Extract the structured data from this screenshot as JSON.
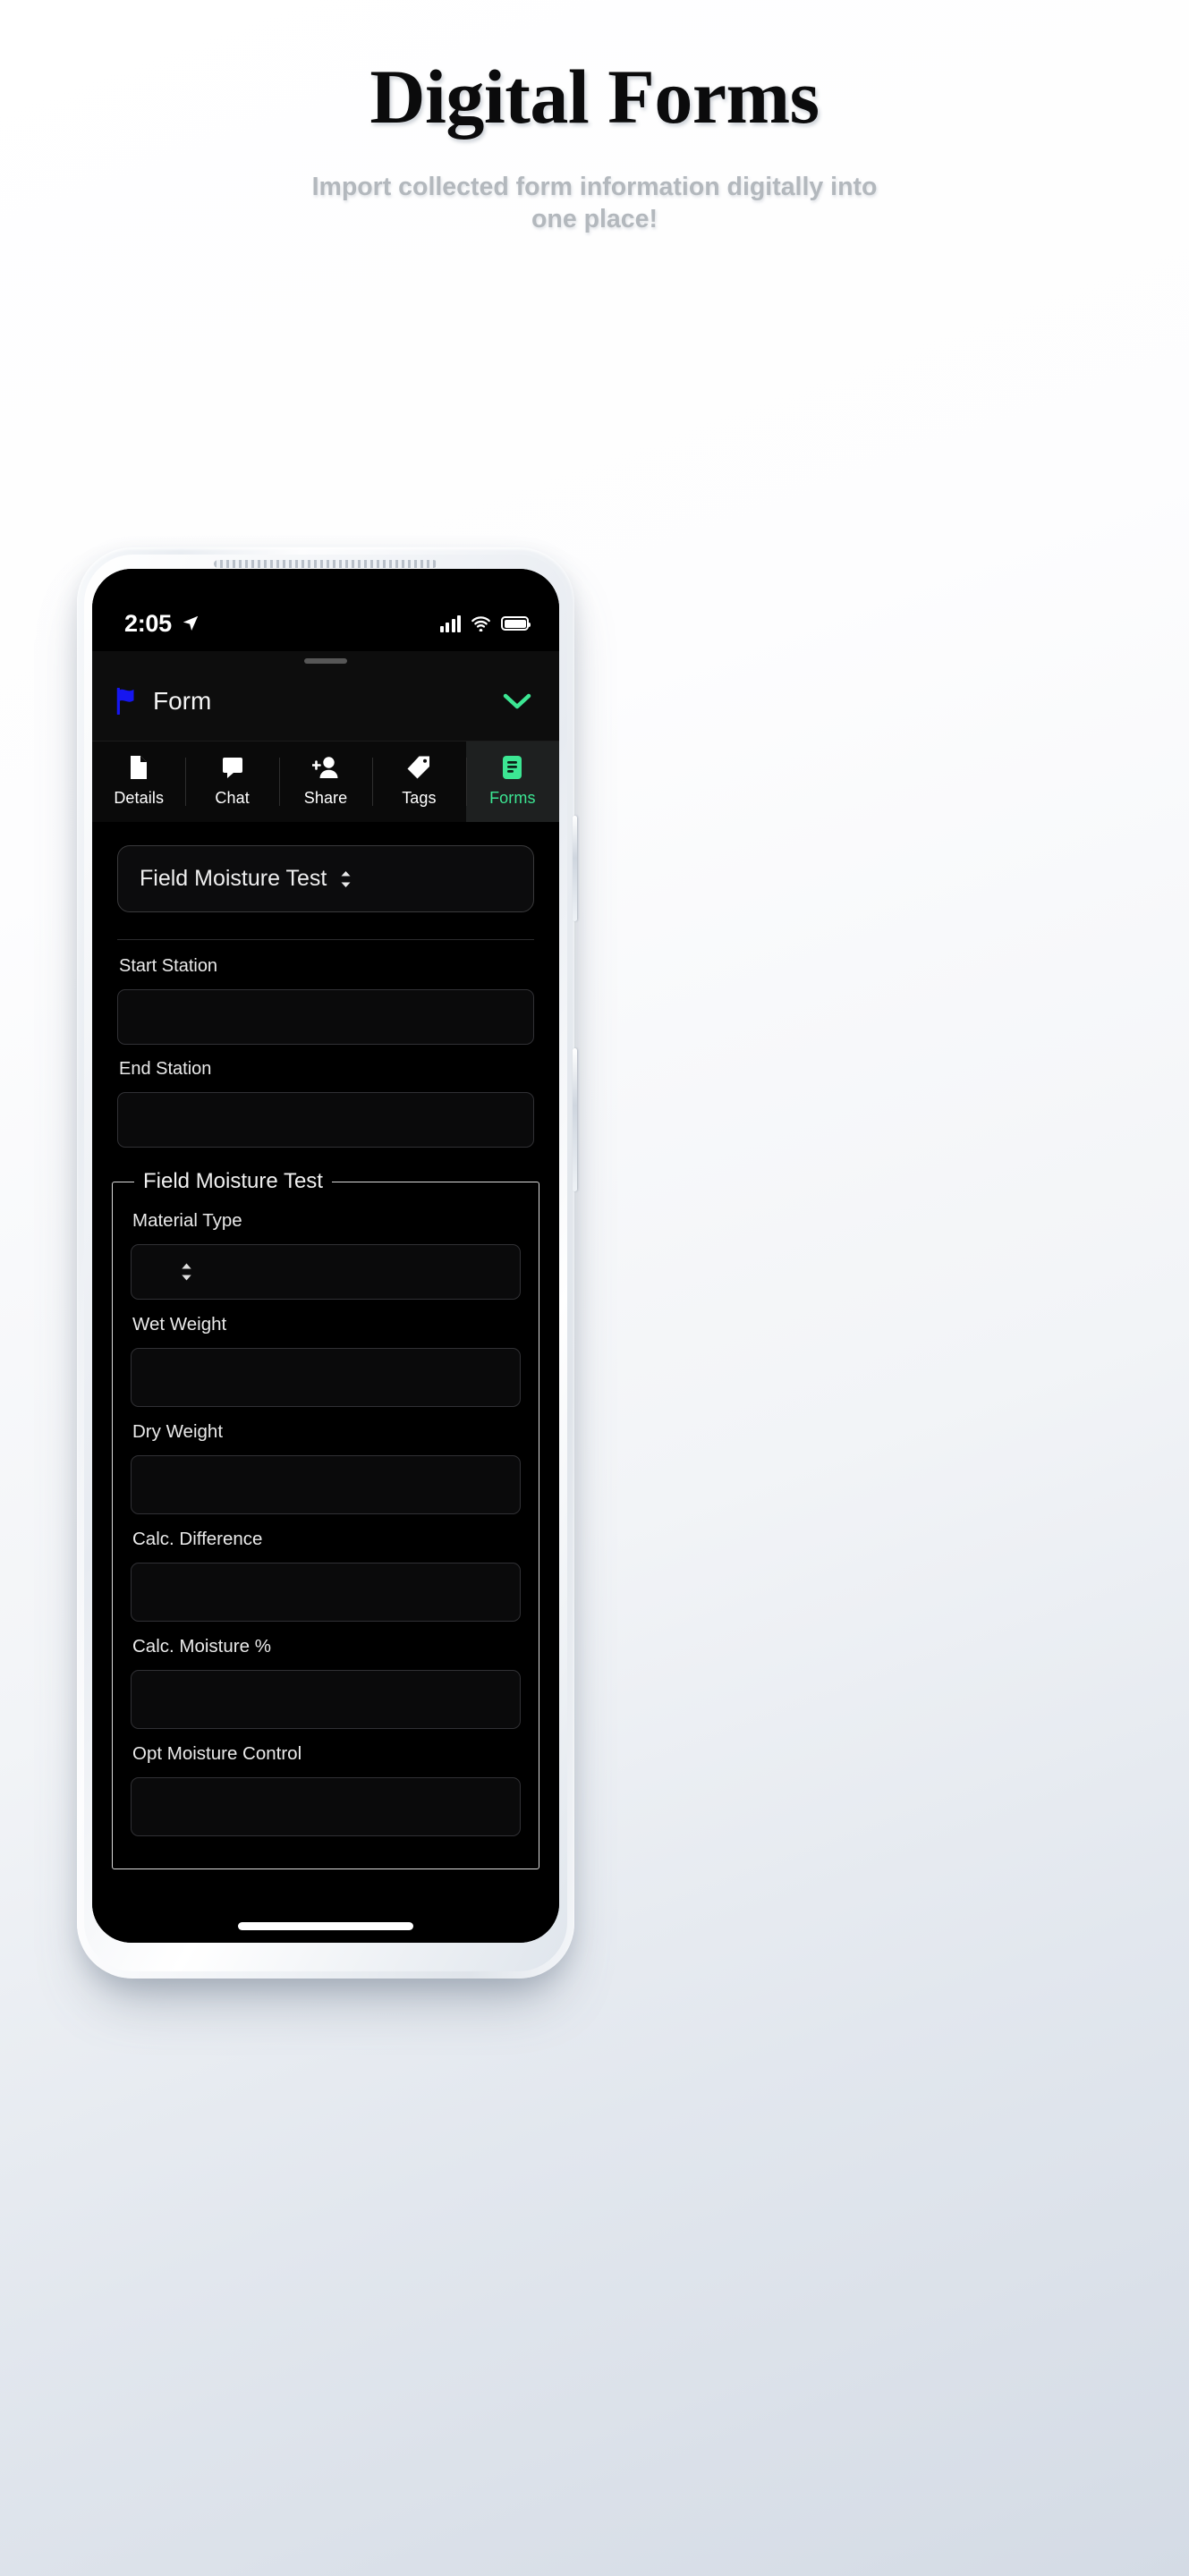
{
  "hero": {
    "title": "Digital Forms",
    "subtitle": "Import collected form information digitally into one place!"
  },
  "colors": {
    "accent_green": "#3ce693",
    "flag_blue": "#1616f0",
    "screen_bg": "#000000",
    "page_bg": "#d4dbe5"
  },
  "phone": {
    "status_bar": {
      "time": "2:05",
      "location_icon": "location-arrow-icon",
      "signal_icon": "cellular-signal-icon",
      "wifi_icon": "wifi-icon",
      "battery_icon": "battery-full-icon"
    },
    "header": {
      "flag_icon": "flag-icon",
      "title": "Form",
      "collapse_icon": "chevron-down-icon"
    },
    "tabs": [
      {
        "label": "Details",
        "icon": "document-icon",
        "active": false
      },
      {
        "label": "Chat",
        "icon": "chat-bubble-icon",
        "active": false
      },
      {
        "label": "Share",
        "icon": "person-add-icon",
        "active": false
      },
      {
        "label": "Tags",
        "icon": "tag-icon",
        "active": false
      },
      {
        "label": "Forms",
        "icon": "form-list-icon",
        "active": true
      }
    ],
    "form": {
      "form_selector": {
        "value": "Field Moisture Test",
        "icon": "chevron-up-down-icon"
      },
      "fields": [
        {
          "label": "Start Station",
          "value": "",
          "type": "text"
        },
        {
          "label": "End Station",
          "value": "",
          "type": "text"
        }
      ],
      "group": {
        "legend": "Field Moisture Test",
        "fields": [
          {
            "label": "Material Type",
            "value": "",
            "type": "select",
            "icon": "chevron-up-down-icon"
          },
          {
            "label": "Wet Weight",
            "value": "",
            "type": "text"
          },
          {
            "label": "Dry Weight",
            "value": "",
            "type": "text"
          },
          {
            "label": "Calc. Difference",
            "value": "",
            "type": "text"
          },
          {
            "label": "Calc. Moisture %",
            "value": "",
            "type": "text"
          },
          {
            "label": "Opt Moisture Control",
            "value": "",
            "type": "text"
          }
        ]
      }
    }
  }
}
